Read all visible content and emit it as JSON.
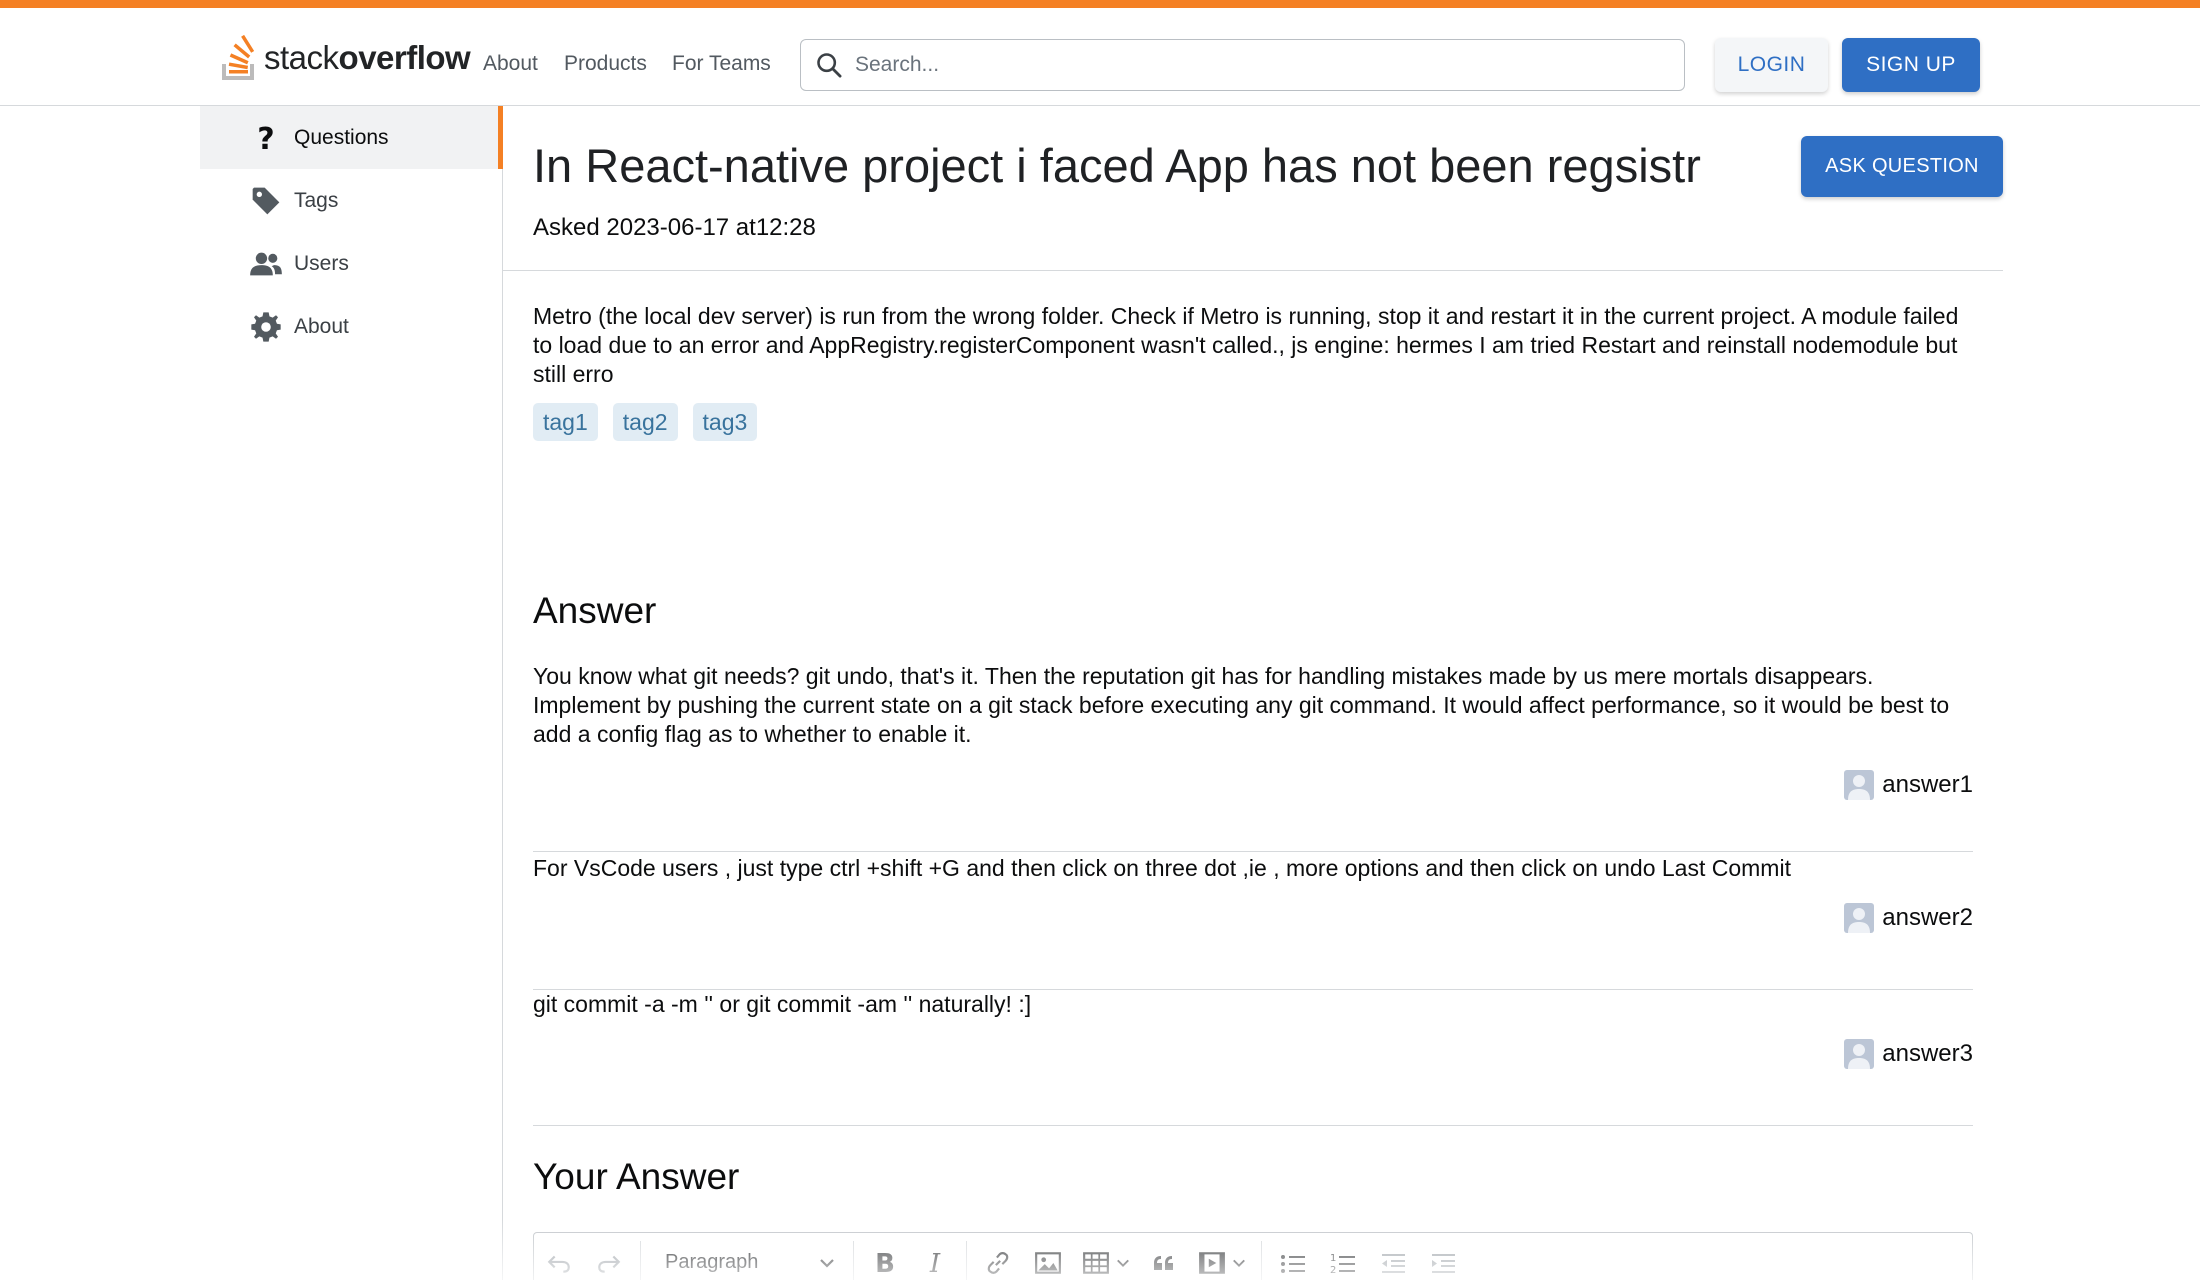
{
  "colors": {
    "accent": "#f48024",
    "primary": "#2f6fc4",
    "tag_bg": "#e1ecf4",
    "tag_text": "#39739d"
  },
  "header": {
    "logo": {
      "light": "stack",
      "bold": "overflow",
      "icon": "stackoverflow-logo-icon"
    },
    "nav": [
      "About",
      "Products",
      "For Teams"
    ],
    "search": {
      "placeholder": "Search...",
      "value": "",
      "icon": "search-icon"
    },
    "login_label": "LOGIN",
    "signup_label": "SIGN UP"
  },
  "sidebar": {
    "items": [
      {
        "label": "Questions",
        "icon": "question-icon",
        "active": true
      },
      {
        "label": "Tags",
        "icon": "tag-icon",
        "active": false
      },
      {
        "label": "Users",
        "icon": "users-icon",
        "active": false
      },
      {
        "label": "About",
        "icon": "gear-icon",
        "active": false
      }
    ]
  },
  "question": {
    "title": "In React-native project i faced App has not been regsistr",
    "asked": "Asked 2023-06-17 at12:28",
    "ask_button_label": "ASK QUESTION",
    "body": "Metro (the local dev server) is run from the wrong folder. Check if Metro is running, stop it and restart it in the current project. A module failed to load due to an error and AppRegistry.registerComponent wasn't called., js engine: hermes I am tried Restart and reinstall nodemodule but still erro",
    "tags": [
      "tag1",
      "tag2",
      "tag3"
    ]
  },
  "answers_section": {
    "title": "Answer",
    "answers": [
      {
        "text": "You know what git needs? git undo, that's it. Then the reputation git has for handling mistakes made by us mere mortals disappears. Implement by pushing the current state on a git stack before executing any git command. It would affect performance, so it would be best to add a config flag as to whether to enable it.",
        "author": "answer1"
      },
      {
        "text": "For VsCode users , just type ctrl +shift +G and then click on three dot ,ie , more options and then click on undo Last Commit",
        "author": "answer2"
      },
      {
        "text": "git commit -a -m '' or git commit -am '' naturally! :]",
        "author": "answer3"
      }
    ]
  },
  "your_answer": {
    "title": "Your Answer",
    "editor": {
      "block_format": "Paragraph",
      "tools": [
        "undo-icon",
        "redo-icon",
        "bold-icon",
        "italic-icon",
        "link-icon",
        "image-icon",
        "table-icon",
        "blockquote-icon",
        "media-embed-icon",
        "bulleted-list-icon",
        "numbered-list-icon",
        "outdent-icon",
        "indent-icon"
      ]
    }
  }
}
